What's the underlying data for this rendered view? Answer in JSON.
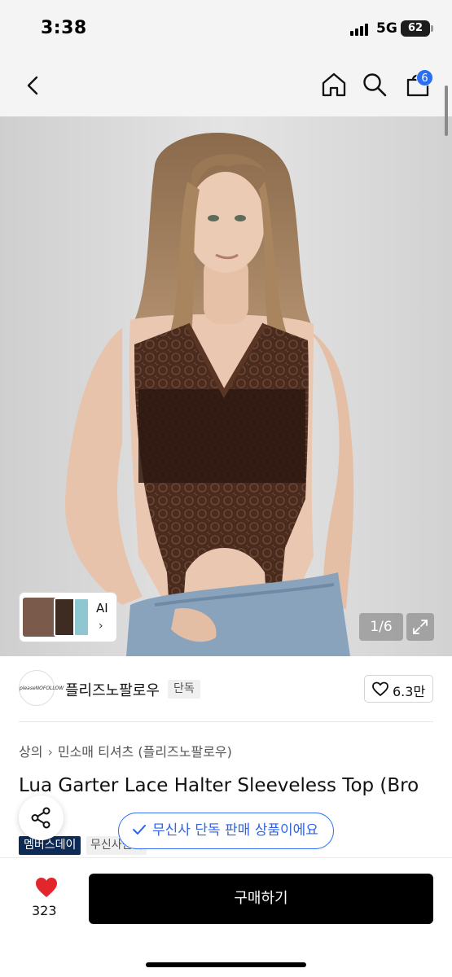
{
  "status_bar": {
    "time": "3:38",
    "network": "5G",
    "battery": "62"
  },
  "nav": {
    "cart_badge": "6"
  },
  "gallery": {
    "counter": "1/6",
    "ai_label": "AI",
    "ai_chevron": "›"
  },
  "brand": {
    "logo_text": "pleaseNOFOLLOW",
    "name": "플리즈노팔로우",
    "tag": "단독",
    "likes": "6.3만"
  },
  "breadcrumb": [
    "상의",
    "민소매 티셔츠 (플리즈노팔로우)"
  ],
  "product": {
    "title": "Lua Garter Lace Halter Sleeveless Top (Bro"
  },
  "tags": {
    "member_day": "멤버스데이",
    "musinsa": "무신사단독"
  },
  "toast": {
    "text": "무신사 단독 판매 상품이에요"
  },
  "bottom_bar": {
    "wishlist_count": "323",
    "buy_label": "구매하기"
  },
  "colors": {
    "accent_blue": "#2b6ef2",
    "heart_red": "#e3262b",
    "tag_navy": "#0e2b55",
    "buy_black": "#000000"
  },
  "icons": [
    "back-arrow-icon",
    "home-icon",
    "search-icon",
    "shopping-bag-icon",
    "expand-icon",
    "heart-outline-icon",
    "share-icon",
    "check-icon",
    "heart-filled-icon"
  ]
}
